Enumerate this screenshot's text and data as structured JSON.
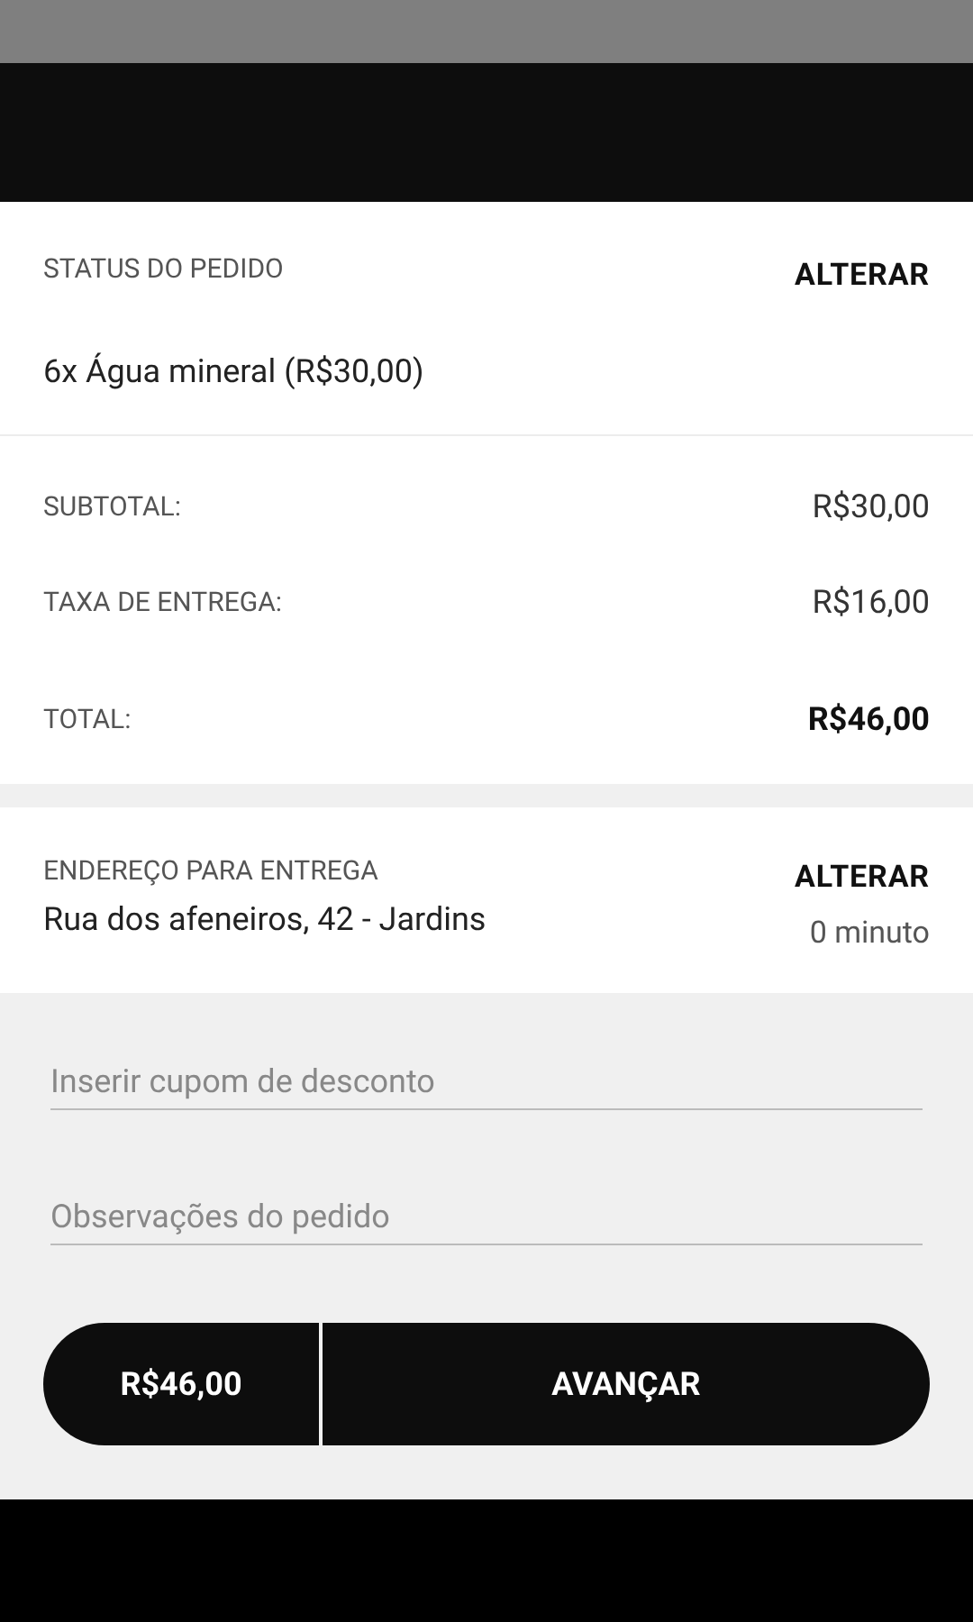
{
  "order_status": {
    "label": "STATUS DO PEDIDO",
    "action": "ALTERAR",
    "items": [
      "6x Água mineral (R$30,00)"
    ]
  },
  "summary": {
    "rows": [
      {
        "label": "SUBTOTAL:",
        "value": "R$30,00",
        "kind": "normal"
      },
      {
        "label": "TAXA DE ENTREGA:",
        "value": "R$16,00",
        "kind": "normal"
      },
      {
        "label": "TOTAL:",
        "value": "R$46,00",
        "kind": "total"
      }
    ]
  },
  "delivery": {
    "label": "ENDEREÇO PARA ENTREGA",
    "address": "Rua dos afeneiros, 42 - Jardins",
    "action": "ALTERAR",
    "time": "0 minuto"
  },
  "fields": [
    {
      "placeholder": "Inserir cupom de desconto"
    },
    {
      "placeholder": "Observações do pedido"
    }
  ],
  "checkout": {
    "price": "R$46,00",
    "button": "AVANÇAR"
  }
}
